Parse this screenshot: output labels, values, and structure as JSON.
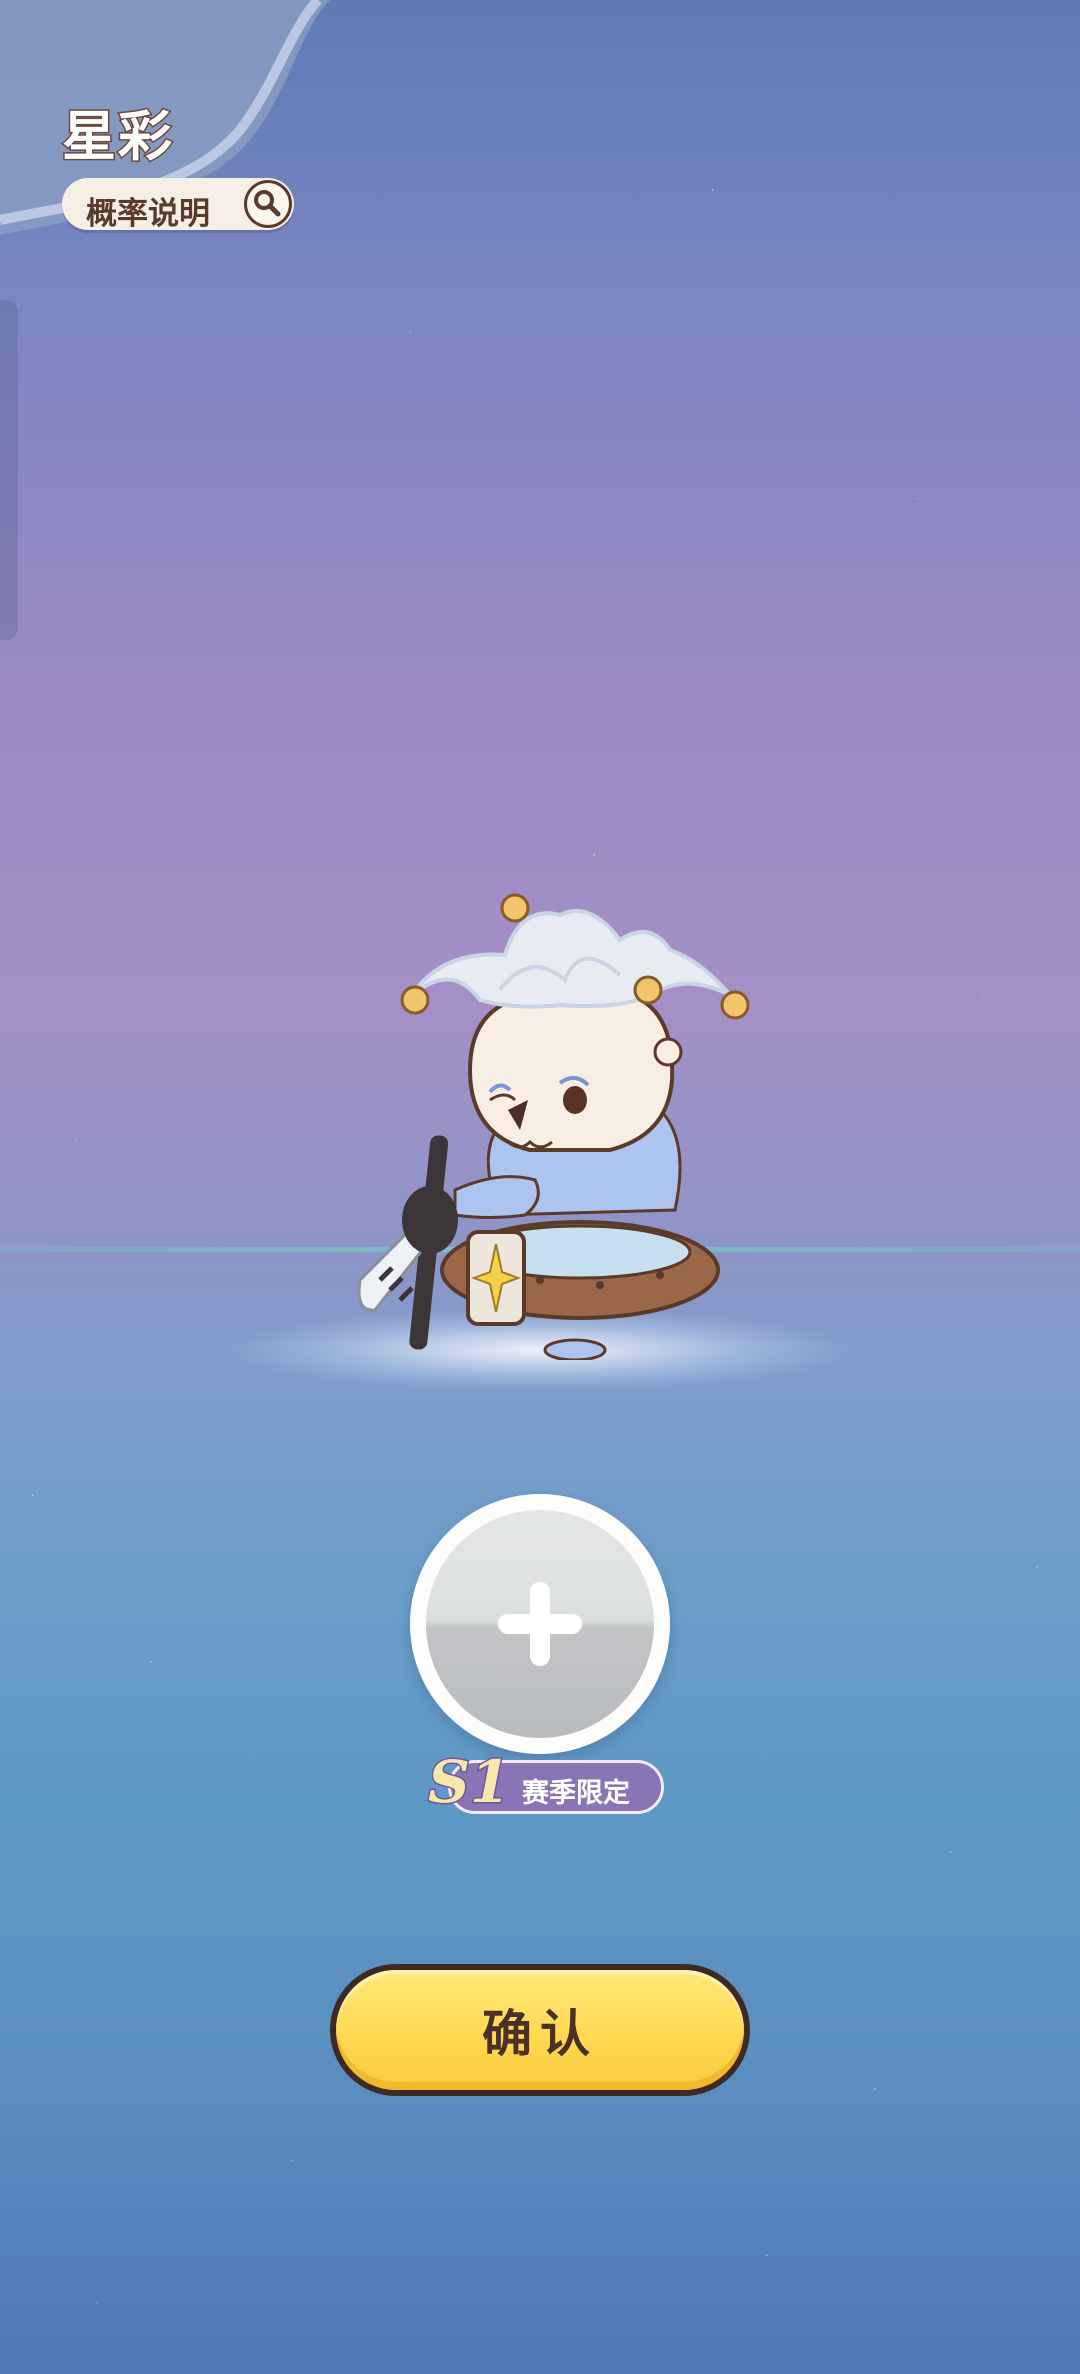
{
  "header": {
    "title": "星彩",
    "probability_label": "概率说明"
  },
  "slot": {
    "badge_season": "S1",
    "badge_text": "赛季限定"
  },
  "actions": {
    "confirm_label": "确认"
  },
  "colors": {
    "confirm_button": "#ffd950",
    "title_outline": "#6b4a3a",
    "badge_purple": "#8b74b6"
  }
}
